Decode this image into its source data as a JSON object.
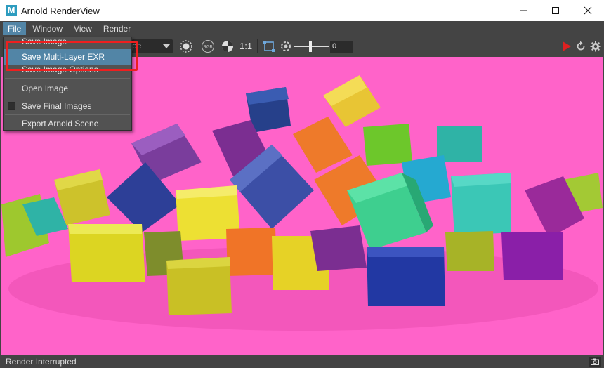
{
  "window": {
    "title": "Arnold RenderView",
    "app_icon_glyph": "M",
    "app_icon": "maya-icon",
    "controls": [
      "minimize-icon",
      "maximize-icon",
      "close-icon"
    ]
  },
  "menubar": {
    "items": [
      "File",
      "Window",
      "View",
      "Render"
    ],
    "active": "File"
  },
  "toolbar": {
    "camera_combo": "pe",
    "display_mode": "RGB",
    "ratio_label": "1:1",
    "exposure_value": "0",
    "icons": [
      "render-region-icon",
      "rgb-icon",
      "checker-icon",
      "crop-icon",
      "exposure-icon",
      "play-icon",
      "refresh-icon",
      "gear-icon"
    ],
    "accent_color": "#e02020"
  },
  "file_menu": {
    "items": [
      {
        "label": "Save Image",
        "state": "partially-hidden"
      },
      {
        "label": "Save Multi-Layer EXR",
        "state": "highlighted"
      },
      {
        "label": "Save Image Options",
        "state": "partially-hidden"
      },
      {
        "label": "Open Image"
      },
      {
        "label": "Save Final Images",
        "checkbox": true,
        "checked": false
      },
      {
        "label": "Export Arnold Scene"
      }
    ],
    "highlight_color": "#5285a6",
    "annotation_color": "#ee1f1f"
  },
  "viewport": {
    "background_color": "#ff63c9",
    "content": "render"
  },
  "statusbar": {
    "text": "Render Interrupted",
    "icon": "snapshot-icon"
  }
}
